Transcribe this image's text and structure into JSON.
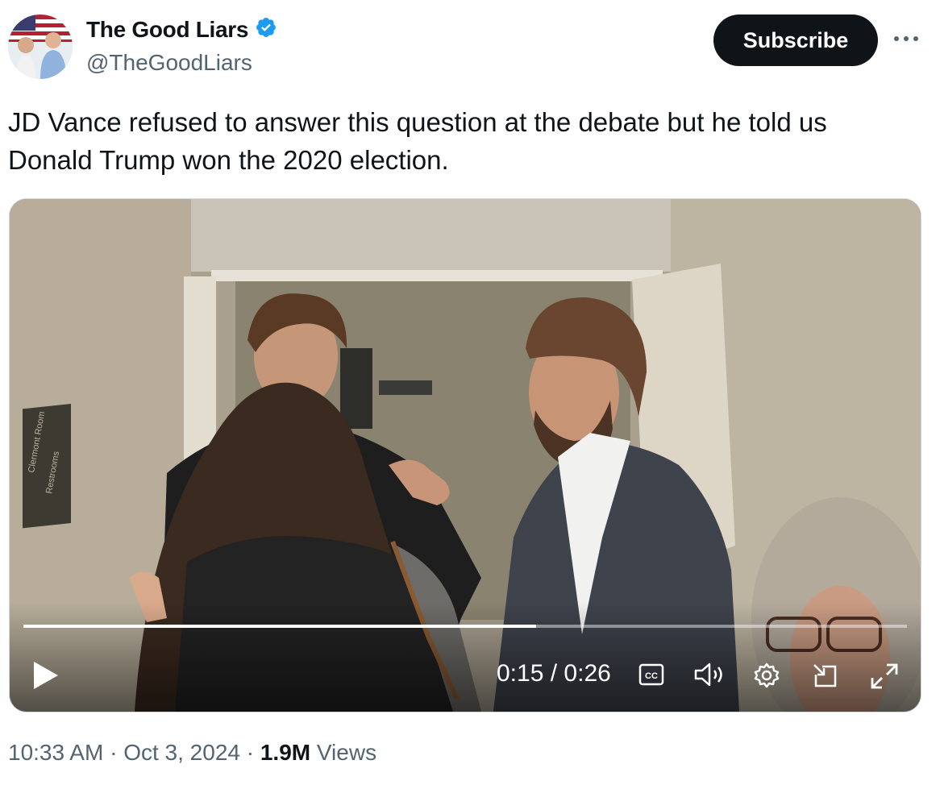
{
  "author": {
    "display_name": "The Good Liars",
    "handle": "@TheGoodLiars",
    "verified": true,
    "badge_color": "#1d9bf0"
  },
  "actions": {
    "subscribe_label": "Subscribe",
    "more_icon": "more-horizontal-icon"
  },
  "tweet": {
    "text": "JD Vance refused to answer this question at the debate but he told us Donald Trump won the 2020 election."
  },
  "video": {
    "current_time": "0:15",
    "separator": "/",
    "duration": "0:26",
    "progress_fraction": 0.58,
    "controls": [
      "play-icon",
      "closed-captions-icon",
      "volume-icon",
      "settings-icon",
      "pop-out-icon",
      "fullscreen-icon"
    ],
    "sign_text": [
      "Clermont Room",
      "Restrooms"
    ]
  },
  "meta": {
    "time": "10:33 AM",
    "dot": "·",
    "date": "Oct 3, 2024",
    "views_count": "1.9M",
    "views_label": "Views"
  }
}
